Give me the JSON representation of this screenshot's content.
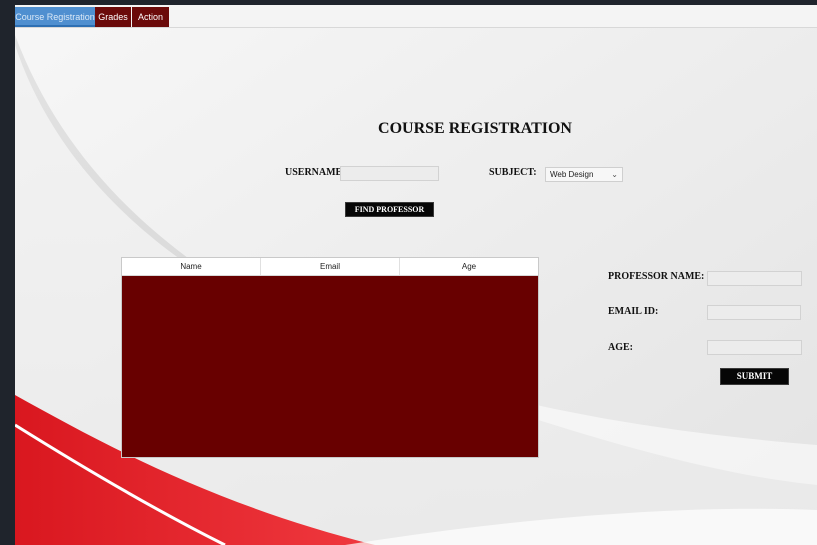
{
  "tabs": [
    {
      "label": "Course Registration",
      "active": true
    },
    {
      "label": "Grades",
      "active": false
    },
    {
      "label": "Action",
      "active": false
    }
  ],
  "title": "COURSE REGISTRATION",
  "form": {
    "username_label": "USERNAME:",
    "username_value": "",
    "subject_label": "SUBJECT:",
    "subject_selected": "Web Design",
    "find_button": "FIND PROFESSOR"
  },
  "table": {
    "columns": [
      "Name",
      "Email",
      "Age"
    ],
    "rows": []
  },
  "details": {
    "professor_name_label": "PROFESSOR NAME:",
    "email_label": "EMAIL ID:",
    "age_label": "AGE:",
    "submit_button": "SUBMIT"
  },
  "colors": {
    "accent_dark_red": "#680000",
    "tab_active_blue": "#4f8fd0",
    "button_black": "#060606",
    "swoosh_red": "#e0202a"
  }
}
